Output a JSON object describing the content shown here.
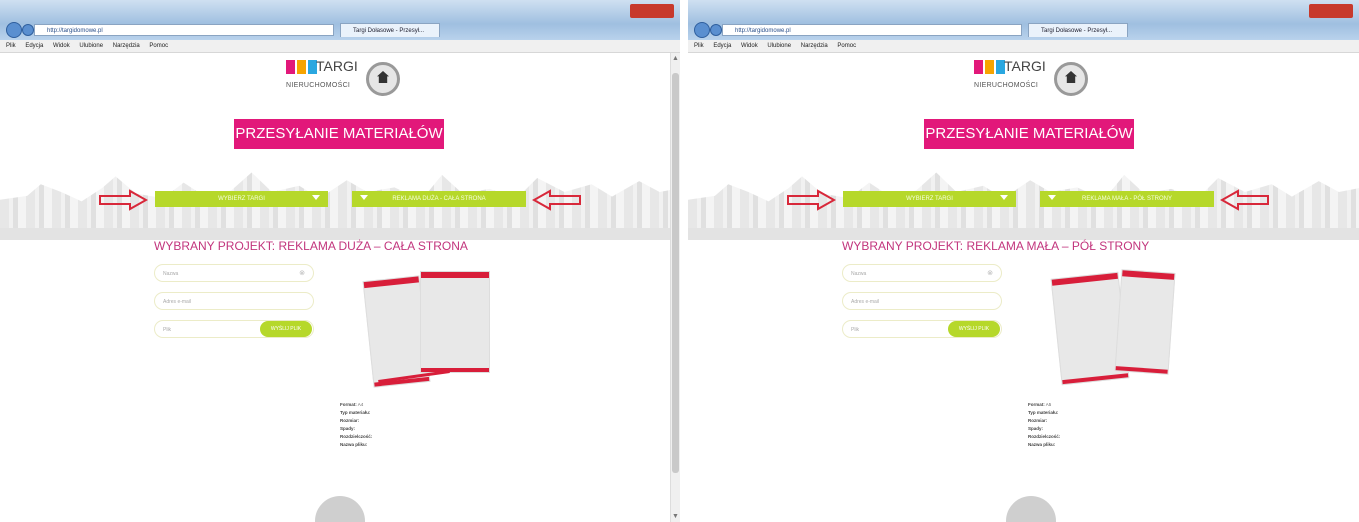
{
  "left": {
    "url": "http://targidomowe.pl",
    "tab": "Targi Dołasowe - Przesył...",
    "menu": [
      "Plik",
      "Edycja",
      "Widok",
      "Ulubione",
      "Narzędzia",
      "Pomoc"
    ],
    "logo": {
      "title": "TARGI",
      "subtitle": "NIERUCHOMOŚCI"
    },
    "banner": "PRZESYŁANIE MATERIAŁÓW",
    "select_event": "WYBIERZ TARGI",
    "select_project": "REKLAMA DUŻA - CAŁA STRONA",
    "project_title": "WYBRANY PROJEKT: REKLAMA DUŻA – CAŁA STRONA",
    "fields": {
      "name": "Nazwa",
      "email": "Adres e-mail",
      "file": "Plik"
    },
    "send": "WYŚLIJ PLIK",
    "specs": [
      {
        "label": "Format:",
        "value": "A4"
      },
      {
        "label": "Typ materiału:",
        "value": ""
      },
      {
        "label": "Rozmiar:",
        "value": ""
      },
      {
        "label": "Spady:",
        "value": ""
      },
      {
        "label": "Rozdzielczość:",
        "value": ""
      },
      {
        "label": "Nazwa pliku:",
        "value": ""
      }
    ]
  },
  "right": {
    "url": "http://targidomowe.pl",
    "tab": "Targi Dołasowe - Przesył...",
    "menu": [
      "Plik",
      "Edycja",
      "Widok",
      "Ulubione",
      "Narzędzia",
      "Pomoc"
    ],
    "logo": {
      "title": "TARGI",
      "subtitle": "NIERUCHOMOŚCI"
    },
    "banner": "PRZESYŁANIE MATERIAŁÓW",
    "select_event": "WYBIERZ TARGI",
    "select_project": "REKLAMA MAŁA - PÓŁ STRONY",
    "project_title": "WYBRANY PROJEKT: REKLAMA MAŁA – PÓŁ STRONY",
    "fields": {
      "name": "Nazwa",
      "email": "Adres e-mail",
      "file": "Plik"
    },
    "send": "WYŚLIJ PLIK",
    "specs": [
      {
        "label": "Format:",
        "value": "A5"
      },
      {
        "label": "Typ materiału:",
        "value": ""
      },
      {
        "label": "Rozmiar:",
        "value": ""
      },
      {
        "label": "Spady:",
        "value": ""
      },
      {
        "label": "Rozdzielczość:",
        "value": ""
      },
      {
        "label": "Nazwa pliku:",
        "value": ""
      }
    ]
  },
  "colors": {
    "magenta": "#e2187a",
    "lime": "#b6d82a",
    "red": "#d81e3a",
    "title": "#c2357d"
  }
}
